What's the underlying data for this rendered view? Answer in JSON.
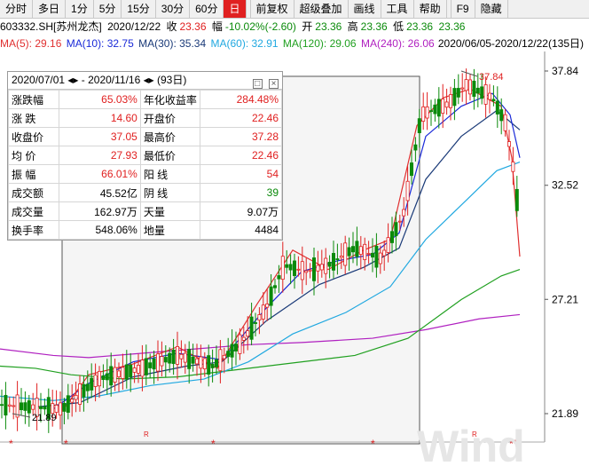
{
  "toolbar": {
    "items": [
      {
        "label": "分时",
        "active": false
      },
      {
        "label": "多日",
        "active": false
      },
      {
        "label": "1分",
        "active": false
      },
      {
        "label": "5分",
        "active": false
      },
      {
        "label": "15分",
        "active": false
      },
      {
        "label": "30分",
        "active": false
      },
      {
        "label": "60分",
        "active": false
      },
      {
        "label": "日",
        "active": true
      },
      {
        "label": "前复权",
        "active": false
      },
      {
        "label": "超级叠加",
        "active": false
      },
      {
        "label": "画线",
        "active": false
      },
      {
        "label": "工具",
        "active": false
      },
      {
        "label": "帮助",
        "active": false
      },
      {
        "label": "F9",
        "active": false
      },
      {
        "label": "隐藏",
        "active": false
      }
    ]
  },
  "quote": {
    "code": "603332.SH[苏州龙杰]",
    "date": "2020/12/22",
    "close_label": "收",
    "close": "23.36",
    "change_label": "幅",
    "change": "-10.02%(-2.60)",
    "open_label": "开",
    "open": "23.36",
    "high_label": "高",
    "high": "23.36",
    "low_label": "低",
    "low": "23.36",
    "extra": "23.36"
  },
  "ma": {
    "ma5": "MA(5): 29.16",
    "ma10": "MA(10): 32.75",
    "ma30": "MA(30): 35.34",
    "ma60": "MA(60): 32.91",
    "ma120": "MA(120): 29.06",
    "ma240": "MA(240): 26.06",
    "range": "2020/06/05-2020/12/22(135日)"
  },
  "colors": {
    "ma5": "#e03030",
    "ma10": "#1a2ad8",
    "ma30": "#1a3a78",
    "ma60": "#20a8e0",
    "ma120": "#20a020",
    "ma240": "#b020c0",
    "up": "#e02020",
    "down": "#0a8a0a"
  },
  "stats": {
    "header": "2020/07/01 ◂▸ - 2020/11/16 ◂▸ (93日)",
    "rows": [
      {
        "l1": "涨跌幅",
        "v1": "65.03%",
        "c1": "red",
        "l2": "年化收益率",
        "v2": "284.48%",
        "c2": "red"
      },
      {
        "l1": "涨   跌",
        "v1": "14.60",
        "c1": "red",
        "l2": "开盘价",
        "v2": "22.46",
        "c2": "red"
      },
      {
        "l1": "收盘价",
        "v1": "37.05",
        "c1": "red",
        "l2": "最高价",
        "v2": "37.28",
        "c2": "red"
      },
      {
        "l1": "均   价",
        "v1": "27.93",
        "c1": "red",
        "l2": "最低价",
        "v2": "22.46",
        "c2": "red"
      },
      {
        "l1": "振   幅",
        "v1": "66.01%",
        "c1": "red",
        "l2": "阳   线",
        "v2": "54",
        "c2": "red"
      },
      {
        "l1": "成交额",
        "v1": "45.52亿",
        "c1": "black",
        "l2": "阴   线",
        "v2": "39",
        "c2": "green"
      },
      {
        "l1": "成交量",
        "v1": "162.97万",
        "c1": "black",
        "l2": "天量",
        "v2": "9.07万",
        "c2": "black"
      },
      {
        "l1": "换手率",
        "v1": "548.06%",
        "c1": "black",
        "l2": "地量",
        "v2": "4484",
        "c2": "black"
      }
    ]
  },
  "chart_data": {
    "type": "candlestick",
    "y_ticks": [
      "37.84",
      "32.52",
      "27.21",
      "21.89"
    ],
    "ylim": [
      21.89,
      37.84
    ],
    "annotations": [
      {
        "label": "37.84",
        "value": 37.84
      },
      {
        "label": "21.89",
        "value": 21.89
      }
    ],
    "markers": [
      "*",
      "*",
      "R",
      "*",
      "*",
      "R",
      "***"
    ],
    "watermark": "Wind"
  }
}
